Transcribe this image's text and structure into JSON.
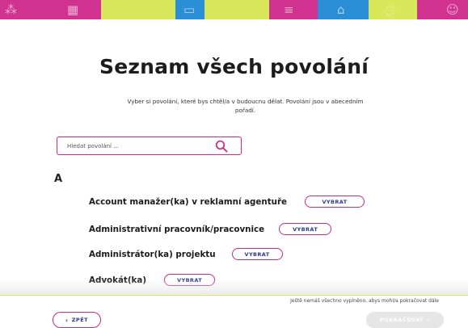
{
  "header": {
    "banner_segments": [
      {
        "color": "#d1318f",
        "icon": "dna-icon"
      },
      {
        "color": "#d1318f",
        "icon": "building-icon"
      },
      {
        "color": "#d8e85a",
        "icon": ""
      },
      {
        "color": "#2a8fd6",
        "icon": "monitor-icon"
      },
      {
        "color": "#d8e85a",
        "icon": ""
      },
      {
        "color": "#d1318f",
        "icon": "chart-icon"
      },
      {
        "color": "#2a8fd6",
        "icon": "house-icon"
      },
      {
        "color": "#d8e85a",
        "icon": "chat-icon"
      },
      {
        "color": "#d1318f",
        "icon": "person-icon"
      }
    ]
  },
  "page": {
    "title": "Seznam všech povolání",
    "subtitle": "Vyber si povolání, které bys chtěl/a v budoucnu dělat. Povolání jsou v abecedním pořadí."
  },
  "search": {
    "placeholder": "Hledat povolání ...",
    "icon": "search-icon"
  },
  "list": {
    "letter": "A",
    "select_label": "VYBRAT",
    "items": [
      {
        "label": "Account manažer(ka) v reklamní agentuře"
      },
      {
        "label": "Administrativní pracovník/pracovnice"
      },
      {
        "label": "Administrátor(ka) projektu"
      },
      {
        "label": "Advokát(ka)"
      }
    ]
  },
  "footer": {
    "notice": "Ještě nemáš všechno vyplněno, abys mohl/a pokračovat dále",
    "back_label": "ZPĚT",
    "next_label": "POKRAČOVAT"
  },
  "colors": {
    "accent": "#c42c87",
    "button_text": "#2a3a86",
    "disabled": "#e6e6e6"
  }
}
